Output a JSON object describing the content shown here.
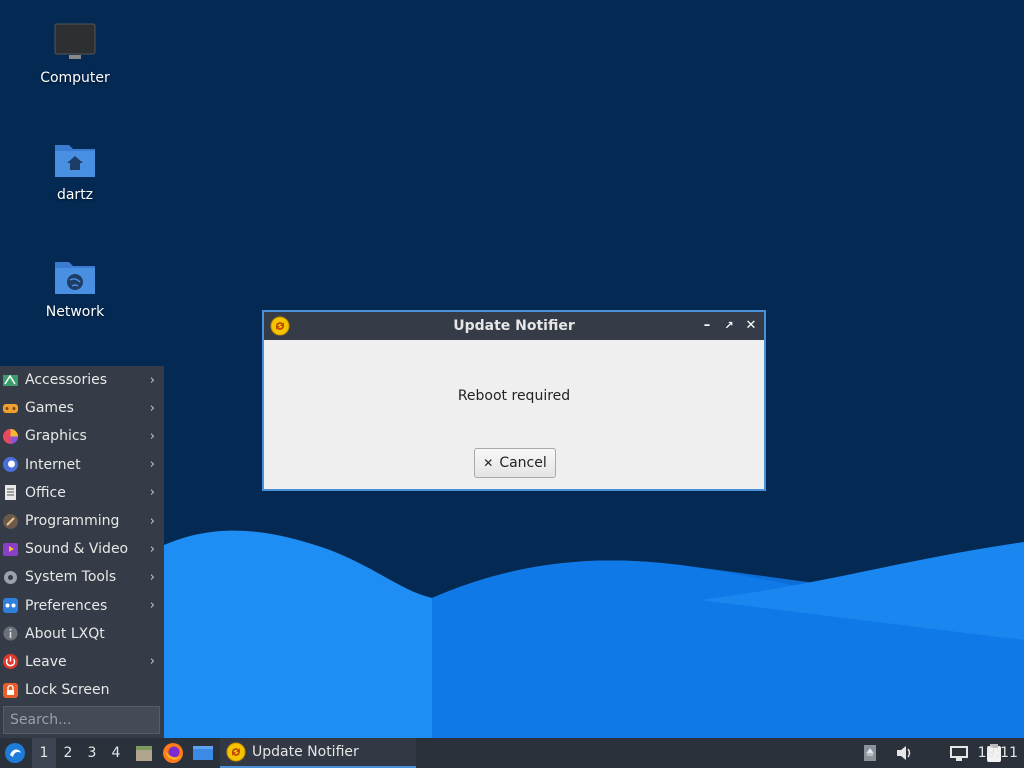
{
  "desktop": {
    "icons": [
      {
        "label": "Computer",
        "icon": "computer-icon"
      },
      {
        "label": "dartz",
        "icon": "home-folder-icon"
      },
      {
        "label": "Network",
        "icon": "network-folder-icon"
      }
    ],
    "colors": {
      "background": "#042a54",
      "wave_light": "#1e90ff",
      "wave_dark": "#0a6fd6"
    }
  },
  "dialog": {
    "title": "Update Notifier",
    "message": "Reboot required",
    "cancel_label": "Cancel",
    "icon": "update-notifier-icon",
    "controls": [
      "minimize-icon",
      "maximize-icon",
      "close-icon"
    ]
  },
  "start_menu": {
    "items": [
      {
        "label": "Accessories",
        "icon": "accessories-icon",
        "submenu": true
      },
      {
        "label": "Games",
        "icon": "games-icon",
        "submenu": true
      },
      {
        "label": "Graphics",
        "icon": "graphics-icon",
        "submenu": true
      },
      {
        "label": "Internet",
        "icon": "internet-icon",
        "submenu": true
      },
      {
        "label": "Office",
        "icon": "office-icon",
        "submenu": true
      },
      {
        "label": "Programming",
        "icon": "programming-icon",
        "submenu": true
      },
      {
        "label": "Sound & Video",
        "icon": "sound-video-icon",
        "submenu": true
      },
      {
        "label": "System Tools",
        "icon": "system-tools-icon",
        "submenu": true
      },
      {
        "label": "Preferences",
        "icon": "preferences-icon",
        "submenu": true
      },
      {
        "label": "About LXQt",
        "icon": "info-icon",
        "submenu": false
      },
      {
        "label": "Leave",
        "icon": "power-icon",
        "submenu": true
      },
      {
        "label": "Lock Screen",
        "icon": "lock-icon",
        "submenu": false
      }
    ],
    "search_placeholder": "Search..."
  },
  "taskbar": {
    "workspaces": [
      "1",
      "2",
      "3",
      "4"
    ],
    "active_workspace": "1",
    "quicklaunch": [
      "file-manager-icon",
      "firefox-icon",
      "show-desktop-icon"
    ],
    "tasks": [
      {
        "label": "Update Notifier",
        "icon": "update-notifier-icon"
      }
    ],
    "tray": [
      "removable-media-icon",
      "volume-icon",
      "network-icon",
      "clipboard-icon"
    ],
    "clock": "19:11"
  }
}
